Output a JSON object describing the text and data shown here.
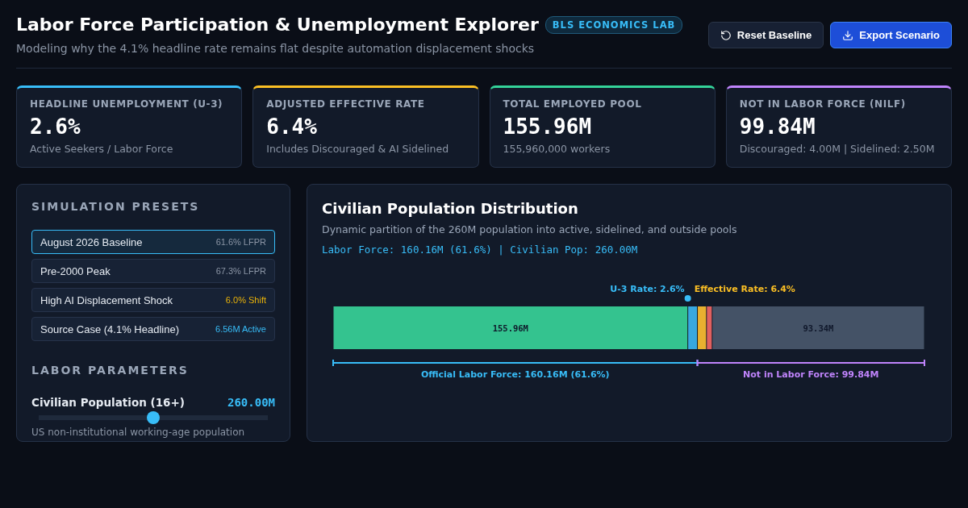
{
  "header": {
    "title": "Labor Force Participation & Unemployment Explorer",
    "badge": "BLS ECONOMICS LAB",
    "subtitle": "Modeling why the 4.1% headline rate remains flat despite automation displacement shocks",
    "buttons": [
      {
        "label": "Reset Baseline",
        "kind": "secondary"
      },
      {
        "label": "Export Scenario",
        "kind": "primary"
      }
    ]
  },
  "stats": [
    {
      "label": "HEADLINE UNEMPLOYMENT (U-3)",
      "value": "2.6%",
      "note": "Active Seekers / Labor Force",
      "color": "#38bdf8"
    },
    {
      "label": "ADJUSTED EFFECTIVE RATE",
      "value": "6.4%",
      "note": "Includes Discouraged & AI Sidelined",
      "color": "#fbbf24"
    },
    {
      "label": "TOTAL EMPLOYED POOL",
      "value": "155.96M",
      "note": "155,960,000 workers",
      "color": "#34d399"
    },
    {
      "label": "NOT IN LABOR FORCE (NILF)",
      "value": "99.84M",
      "note": "Discouraged: 4.00M | Sidelined: 2.50M",
      "color": "#c084fc"
    }
  ],
  "presets": {
    "title": "SIMULATION PRESETS",
    "items": [
      {
        "name": "August 2026 Baseline",
        "tag": "61.6% LFPR",
        "selected": true,
        "color": "#8b95a5"
      },
      {
        "name": "Pre-2000 Peak",
        "tag": "67.3% LFPR",
        "selected": false,
        "color": "#8b95a5"
      },
      {
        "name": "High AI Displacement Shock",
        "tag": "6.0% Shift",
        "selected": false,
        "color": "#eab308"
      },
      {
        "name": "Source Case (4.1% Headline)",
        "tag": "6.56M Active",
        "selected": false,
        "color": "#38bdf8"
      }
    ]
  },
  "parameters": {
    "title": "LABOR PARAMETERS",
    "sliders": [
      {
        "label": "Civilian Population (16+)",
        "reading": "260.00M",
        "level": 0.5,
        "hint": "US non-institutional working-age population"
      }
    ]
  },
  "distribution": {
    "title": "Civilian Population Distribution",
    "subtitle": "Dynamic partition of the 260M population into active, sidelined, and outside pools",
    "summary": "Labor Force: 160.16M (61.6%) | Civilian Pop: 260.00M",
    "segments": [
      {
        "color": "#34c38f",
        "label": "155.96M"
      },
      {
        "color": "#38a8e0"
      },
      {
        "color": "#e8b030"
      },
      {
        "color": "#e06060"
      },
      {
        "color": "#445266",
        "label": "93.34M"
      }
    ],
    "markers": [
      {
        "text": "U-3 Rate: 2.6%",
        "color": "#38bdf8"
      },
      {
        "text": "Effective Rate: 6.4%",
        "color": "#fbbf24"
      }
    ],
    "brackets": [
      {
        "text": "Official Labor Force: 160.16M (61.6%)",
        "color": "#38bdf8"
      },
      {
        "text": "Not in Labor Force: 99.84M",
        "color": "#c084fc"
      }
    ]
  }
}
